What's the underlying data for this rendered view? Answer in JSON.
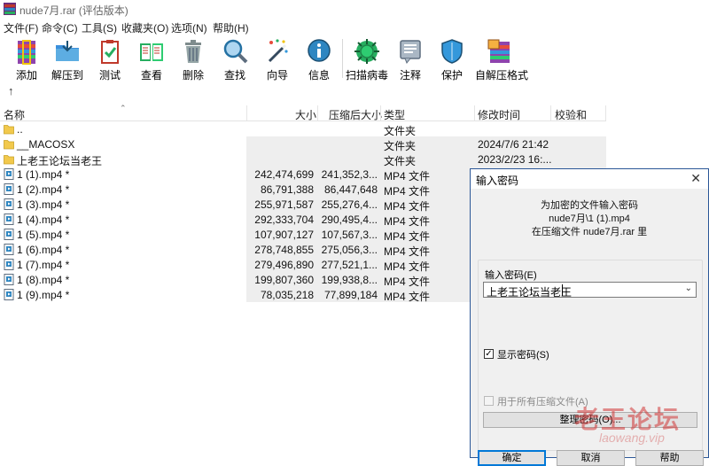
{
  "window": {
    "title": "nude7月.rar (评估版本)"
  },
  "menu": [
    "文件(F)",
    "命令(C)",
    "工具(S)",
    "收藏夹(O)",
    "选项(N)",
    "帮助(H)"
  ],
  "toolbar": {
    "buttons": [
      {
        "label": "添加",
        "icon": "add-archive-icon"
      },
      {
        "label": "解压到",
        "icon": "extract-folder-icon"
      },
      {
        "label": "测试",
        "icon": "test-clipboard-icon"
      },
      {
        "label": "查看",
        "icon": "view-book-icon"
      },
      {
        "label": "删除",
        "icon": "trash-icon"
      },
      {
        "label": "查找",
        "icon": "magnifier-icon"
      },
      {
        "label": "向导",
        "icon": "wizard-wand-icon"
      },
      {
        "label": "信息",
        "icon": "info-icon"
      },
      {
        "label": "扫描病毒",
        "icon": "virus-scan-icon"
      },
      {
        "label": "注释",
        "icon": "comment-icon"
      },
      {
        "label": "保护",
        "icon": "shield-icon"
      },
      {
        "label": "自解压格式",
        "icon": "sfx-icon"
      }
    ]
  },
  "list": {
    "columns": [
      "名称",
      "大小",
      "压缩后大小",
      "类型",
      "修改时间",
      "校验和"
    ],
    "rows": [
      {
        "name": "..",
        "size": "",
        "packed": "",
        "type": "文件夹",
        "modified": "",
        "icon": "folder-up"
      },
      {
        "name": "__MACOSX",
        "size": "",
        "packed": "",
        "type": "文件夹",
        "modified": "2024/7/6 21:42",
        "icon": "folder"
      },
      {
        "name": "上老王论坛当老王",
        "size": "",
        "packed": "",
        "type": "文件夹",
        "modified": "2023/2/23 16:...",
        "icon": "folder"
      },
      {
        "name": "1 (1).mp4 *",
        "size": "242,474,699",
        "packed": "241,352,3...",
        "type": "MP4 文件",
        "modified": "",
        "icon": "video-file"
      },
      {
        "name": "1 (2).mp4 *",
        "size": "86,791,388",
        "packed": "86,447,648",
        "type": "MP4 文件",
        "modified": "",
        "icon": "video-file"
      },
      {
        "name": "1 (3).mp4 *",
        "size": "255,971,587",
        "packed": "255,276,4...",
        "type": "MP4 文件",
        "modified": "",
        "icon": "video-file"
      },
      {
        "name": "1 (4).mp4 *",
        "size": "292,333,704",
        "packed": "290,495,4...",
        "type": "MP4 文件",
        "modified": "",
        "icon": "video-file"
      },
      {
        "name": "1 (5).mp4 *",
        "size": "107,907,127",
        "packed": "107,567,3...",
        "type": "MP4 文件",
        "modified": "",
        "icon": "video-file"
      },
      {
        "name": "1 (6).mp4 *",
        "size": "278,748,855",
        "packed": "275,056,3...",
        "type": "MP4 文件",
        "modified": "",
        "icon": "video-file"
      },
      {
        "name": "1 (7).mp4 *",
        "size": "279,496,890",
        "packed": "277,521,1...",
        "type": "MP4 文件",
        "modified": "",
        "icon": "video-file"
      },
      {
        "name": "1 (8).mp4 *",
        "size": "199,807,360",
        "packed": "199,938,8...",
        "type": "MP4 文件",
        "modified": "",
        "icon": "video-file"
      },
      {
        "name": "1 (9).mp4 *",
        "size": "78,035,218",
        "packed": "77,899,184",
        "type": "MP4 文件",
        "modified": "",
        "icon": "video-file"
      }
    ]
  },
  "dialog": {
    "title": "输入密码",
    "info_line1": "为加密的文件输入密码",
    "info_line2": "nude7月\\1 (1).mp4",
    "info_line3": "在压缩文件 nude7月.rar 里",
    "password_label": "输入密码(E)",
    "password_value": "上老王论坛当老王",
    "show_password_label": "显示密码(S)",
    "show_password_checked": true,
    "use_for_all_label": "用于所有压缩文件(A)",
    "use_for_all_checked": false,
    "organize_button": "整理密码(O)...",
    "ok_button": "确定",
    "cancel_button": "取消",
    "help_button": "帮助"
  },
  "watermark": {
    "text": "老王论坛",
    "sub": "laowang.vip"
  }
}
